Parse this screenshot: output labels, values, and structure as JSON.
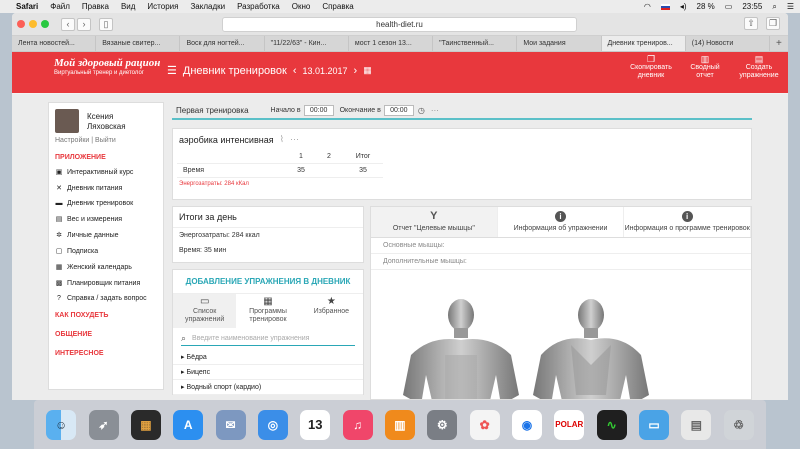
{
  "menubar": {
    "app": "Safari",
    "items": [
      "Файл",
      "Правка",
      "Вид",
      "История",
      "Закладки",
      "Разработка",
      "Окно",
      "Справка"
    ],
    "battery": "28 %",
    "time": "23:55"
  },
  "browser": {
    "url": "health-diet.ru",
    "tabs": [
      "Лента новостей...",
      "Вязаные свитер...",
      "Воск для ногтей...",
      "\"11/22/63\" - Кин...",
      "мост 1 сезон 13...",
      "\"Таинственный...",
      "Мои задания",
      "Дневник трениров...",
      "(14) Новости"
    ]
  },
  "header": {
    "logo_title": "Мой здоровый рацион",
    "logo_subtitle": "Виртуальный тренер и диетолог",
    "page_title": "Дневник тренировок",
    "date": "13.01.2017",
    "buttons": [
      "Скопировать дневник",
      "Сводный отчет",
      "Создать упражнение"
    ]
  },
  "user": {
    "name_line1": "Ксения",
    "name_line2": "Ляховская",
    "settings": "Настройки",
    "logout": "Выйти"
  },
  "sidebar": {
    "section_app": "ПРИЛОЖЕНИЕ",
    "items": [
      {
        "icon": "cart-icon",
        "label": "Интерактивный курс"
      },
      {
        "icon": "utensils-icon",
        "label": "Дневник питания"
      },
      {
        "icon": "dumbbell-icon",
        "label": "Дневник тренировок"
      },
      {
        "icon": "scale-icon",
        "label": "Вес и измерения"
      },
      {
        "icon": "gears-icon",
        "label": "Личные данные"
      },
      {
        "icon": "lock-icon",
        "label": "Подписка"
      },
      {
        "icon": "calendar-icon",
        "label": "Женский календарь"
      },
      {
        "icon": "food-icon",
        "label": "Планировщик питания"
      },
      {
        "icon": "question-icon",
        "label": "Справка / задать вопрос"
      }
    ],
    "section_lose": "КАК ПОХУДЕТЬ",
    "section_social": "ОБЩЕНИЕ",
    "section_interesting": "ИНТЕРЕСНОЕ"
  },
  "workout": {
    "title": "Первая тренировка",
    "start_label": "Начало в",
    "start_value": "00:00",
    "end_label": "Окончание в",
    "end_value": "00:00"
  },
  "exercise": {
    "title": "аэробика интенсивная",
    "col_headers": [
      "1",
      "2",
      "Итог"
    ],
    "row_label": "Время",
    "values": [
      "35",
      "",
      "35"
    ],
    "energy": "Энергозатраты: 284 кКал"
  },
  "summary": {
    "title": "Итоги за день",
    "energy": "Энергозатраты: 284 ккал",
    "time": "Время: 35 мин"
  },
  "add_exercise": {
    "title": "ДОБАВЛЕНИЕ УПРАЖНЕНИЯ В ДНЕВНИК",
    "tabs": [
      "Список упражнений",
      "Программы тренировок",
      "Избранное"
    ],
    "search_placeholder": "Введите наименование упражнения",
    "categories": [
      "Бёдра",
      "Бицепс",
      "Водный спорт (кардио)"
    ]
  },
  "info": {
    "tabs": [
      "Отчет \"Целевые мышцы\"",
      "Информация об упражнении",
      "Информация о программе тренировок"
    ],
    "primary_muscles": "Основные мышцы:",
    "secondary_muscles": "Дополнительные мышцы:"
  }
}
